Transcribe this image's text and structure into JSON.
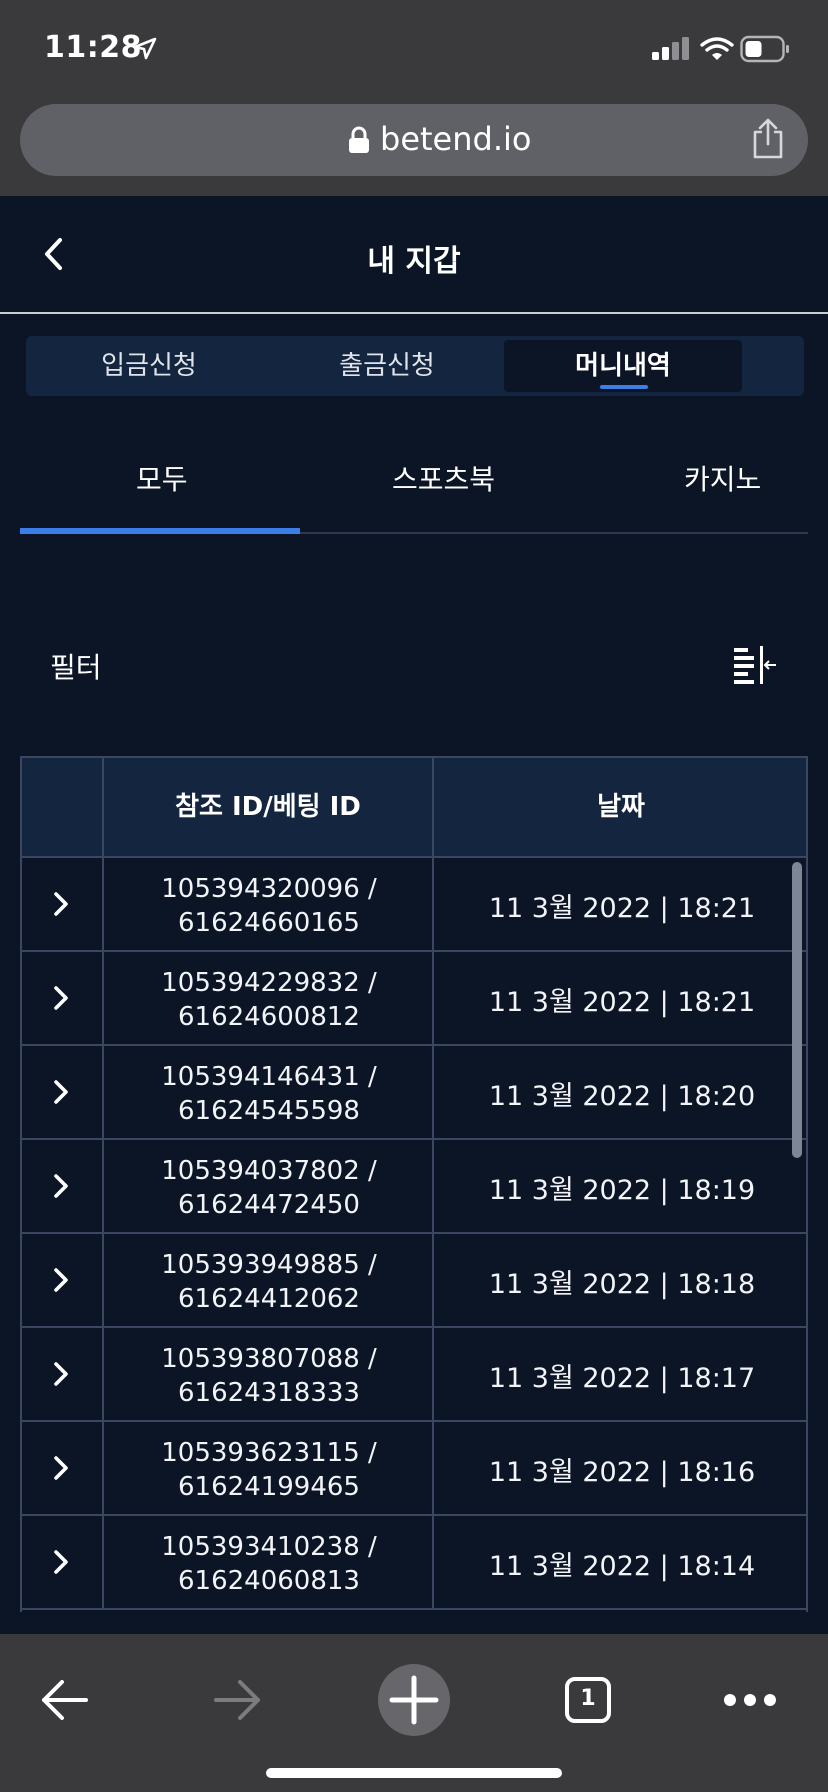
{
  "status_bar": {
    "time": "11:28",
    "icons": [
      "location-arrow-icon",
      "cellular-signal-icon",
      "wifi-icon",
      "battery-icon"
    ]
  },
  "browser": {
    "url": "betend.io",
    "toolbar_tab_count": "1"
  },
  "header": {
    "title": "내 지갑"
  },
  "segment_tabs": [
    {
      "label": "입금신청",
      "active": false
    },
    {
      "label": "출금신청",
      "active": false
    },
    {
      "label": "머니내역",
      "active": true
    }
  ],
  "category_tabs": [
    {
      "label": "모두",
      "active": true
    },
    {
      "label": "스포츠북",
      "active": false
    },
    {
      "label": "카지노",
      "active": false
    }
  ],
  "filter": {
    "label": "필터"
  },
  "table": {
    "columns": [
      "",
      "참조 ID/베팅 ID",
      "날짜"
    ],
    "rows": [
      {
        "ref_id": "105394320096 /",
        "bet_id": "61624660165",
        "date": "11 3월 2022 | 18:21"
      },
      {
        "ref_id": "105394229832 /",
        "bet_id": "61624600812",
        "date": "11 3월 2022 | 18:21"
      },
      {
        "ref_id": "105394146431 /",
        "bet_id": "61624545598",
        "date": "11 3월 2022 | 18:20"
      },
      {
        "ref_id": "105394037802 /",
        "bet_id": "61624472450",
        "date": "11 3월 2022 | 18:19"
      },
      {
        "ref_id": "105393949885 /",
        "bet_id": "61624412062",
        "date": "11 3월 2022 | 18:18"
      },
      {
        "ref_id": "105393807088 /",
        "bet_id": "61624318333",
        "date": "11 3월 2022 | 18:17"
      },
      {
        "ref_id": "105393623115 /",
        "bet_id": "61624199465",
        "date": "11 3월 2022 | 18:16"
      },
      {
        "ref_id": "105393410238 /",
        "bet_id": "61624060813",
        "date": "11 3월 2022 | 18:14"
      }
    ]
  },
  "colors": {
    "background": "#0b1526",
    "panel": "#14253f",
    "accent": "#3a7ee6",
    "browser_chrome": "#3a3a3c"
  }
}
